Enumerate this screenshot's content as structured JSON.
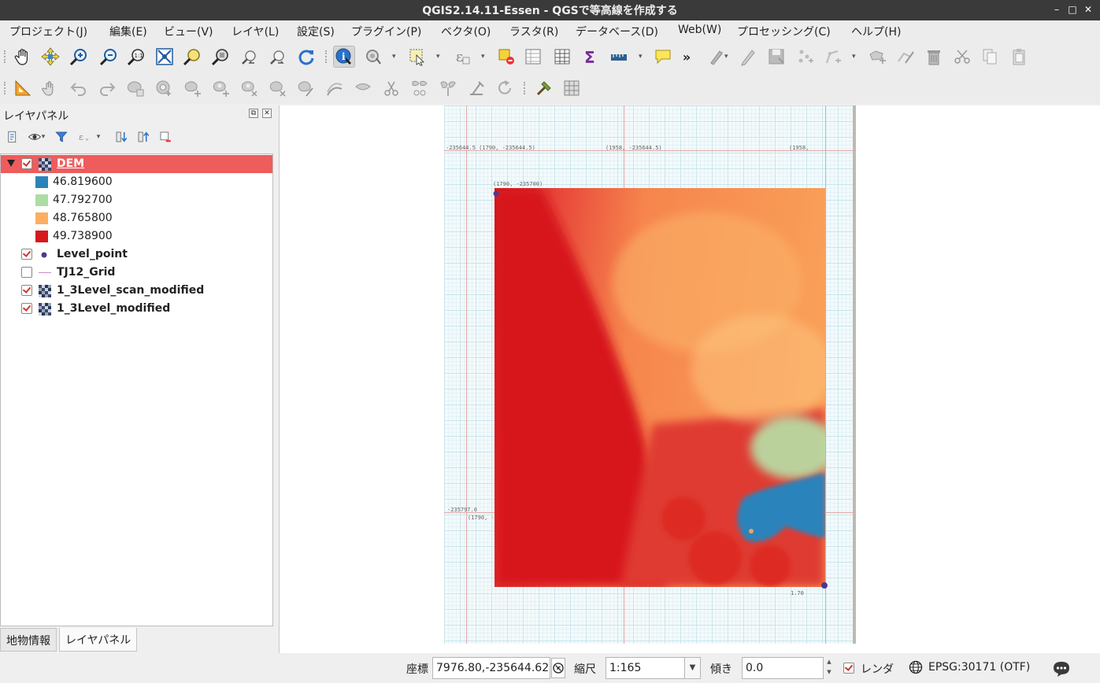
{
  "window": {
    "title": "QGIS2.14.11-Essen - QGSで等高線を作成する",
    "minimize": "–",
    "maximize": "□",
    "close": "✕"
  },
  "menu": {
    "project": "プロジェクト(J)",
    "edit": "編集(E)",
    "view": "ビュー(V)",
    "layer": "レイヤ(L)",
    "settings": "設定(S)",
    "plugins": "プラグイン(P)",
    "vector": "ベクタ(O)",
    "raster": "ラスタ(R)",
    "database": "データベース(D)",
    "web": "Web(W)",
    "processing": "プロセッシング(C)",
    "help": "ヘルプ(H)"
  },
  "toolbar": {
    "more": "»"
  },
  "layer_panel": {
    "title": "レイヤパネル",
    "float_icon": "⧉",
    "close_icon": "✕",
    "layers": [
      {
        "name": "DEM",
        "checked": true,
        "type": "raster",
        "selected": true
      },
      {
        "name": "Level_point",
        "checked": true,
        "type": "point"
      },
      {
        "name": "TJ12_Grid",
        "checked": false,
        "type": "line"
      },
      {
        "name": "1_3Level_scan_modified",
        "checked": true,
        "type": "raster"
      },
      {
        "name": "1_3Level_modified",
        "checked": true,
        "type": "raster"
      }
    ],
    "dem_legend": [
      {
        "value": "46.819600",
        "color": "#2b83ba"
      },
      {
        "value": "47.792700",
        "color": "#abdda4"
      },
      {
        "value": "48.765800",
        "color": "#fdae61"
      },
      {
        "value": "49.738900",
        "color": "#d7191c"
      }
    ]
  },
  "tabs": {
    "identify": "地物情報",
    "layers": "レイヤパネル"
  },
  "map": {
    "scan_notes": [
      "-235644.5 (1790, -235644.5)",
      "(1958, -235644.5)",
      "(1790, -235700)",
      "-235797.0",
      "(1790, -235797)",
      "(1958,",
      "1.70"
    ]
  },
  "statusbar": {
    "coord_label": "座標",
    "coord_value": "7976.80,-235644.62",
    "scale_label": "縮尺",
    "scale_value": "1:165",
    "rotation_label": "傾き",
    "rotation_value": "0.0",
    "render_label": "レンダ",
    "crs": "EPSG:30171 (OTF)"
  }
}
